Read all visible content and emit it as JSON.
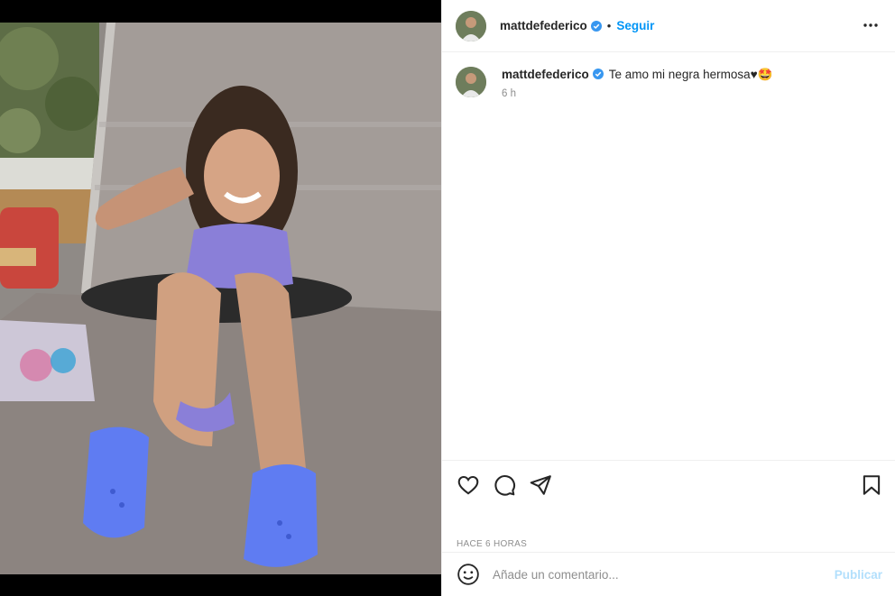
{
  "post": {
    "username": "mattdefederico",
    "follow_label": "Seguir",
    "separator": "•",
    "caption_text": "Te amo mi negra hermosa♥🤩",
    "relative_time": "6 h",
    "timestamp": "HACE 6 HORAS"
  },
  "comment": {
    "placeholder": "Añade un comentario...",
    "publish_label": "Publicar"
  },
  "icons": {
    "verified": "verified-badge-icon",
    "more": "more-options-icon",
    "like": "heart-icon",
    "comment": "comment-icon",
    "share": "send-icon",
    "save": "bookmark-icon",
    "emoji": "emoji-icon"
  },
  "colors": {
    "accent": "#0095f6",
    "publish_disabled": "#b2dffc",
    "muted": "#8e8e8e",
    "text": "#262626"
  }
}
